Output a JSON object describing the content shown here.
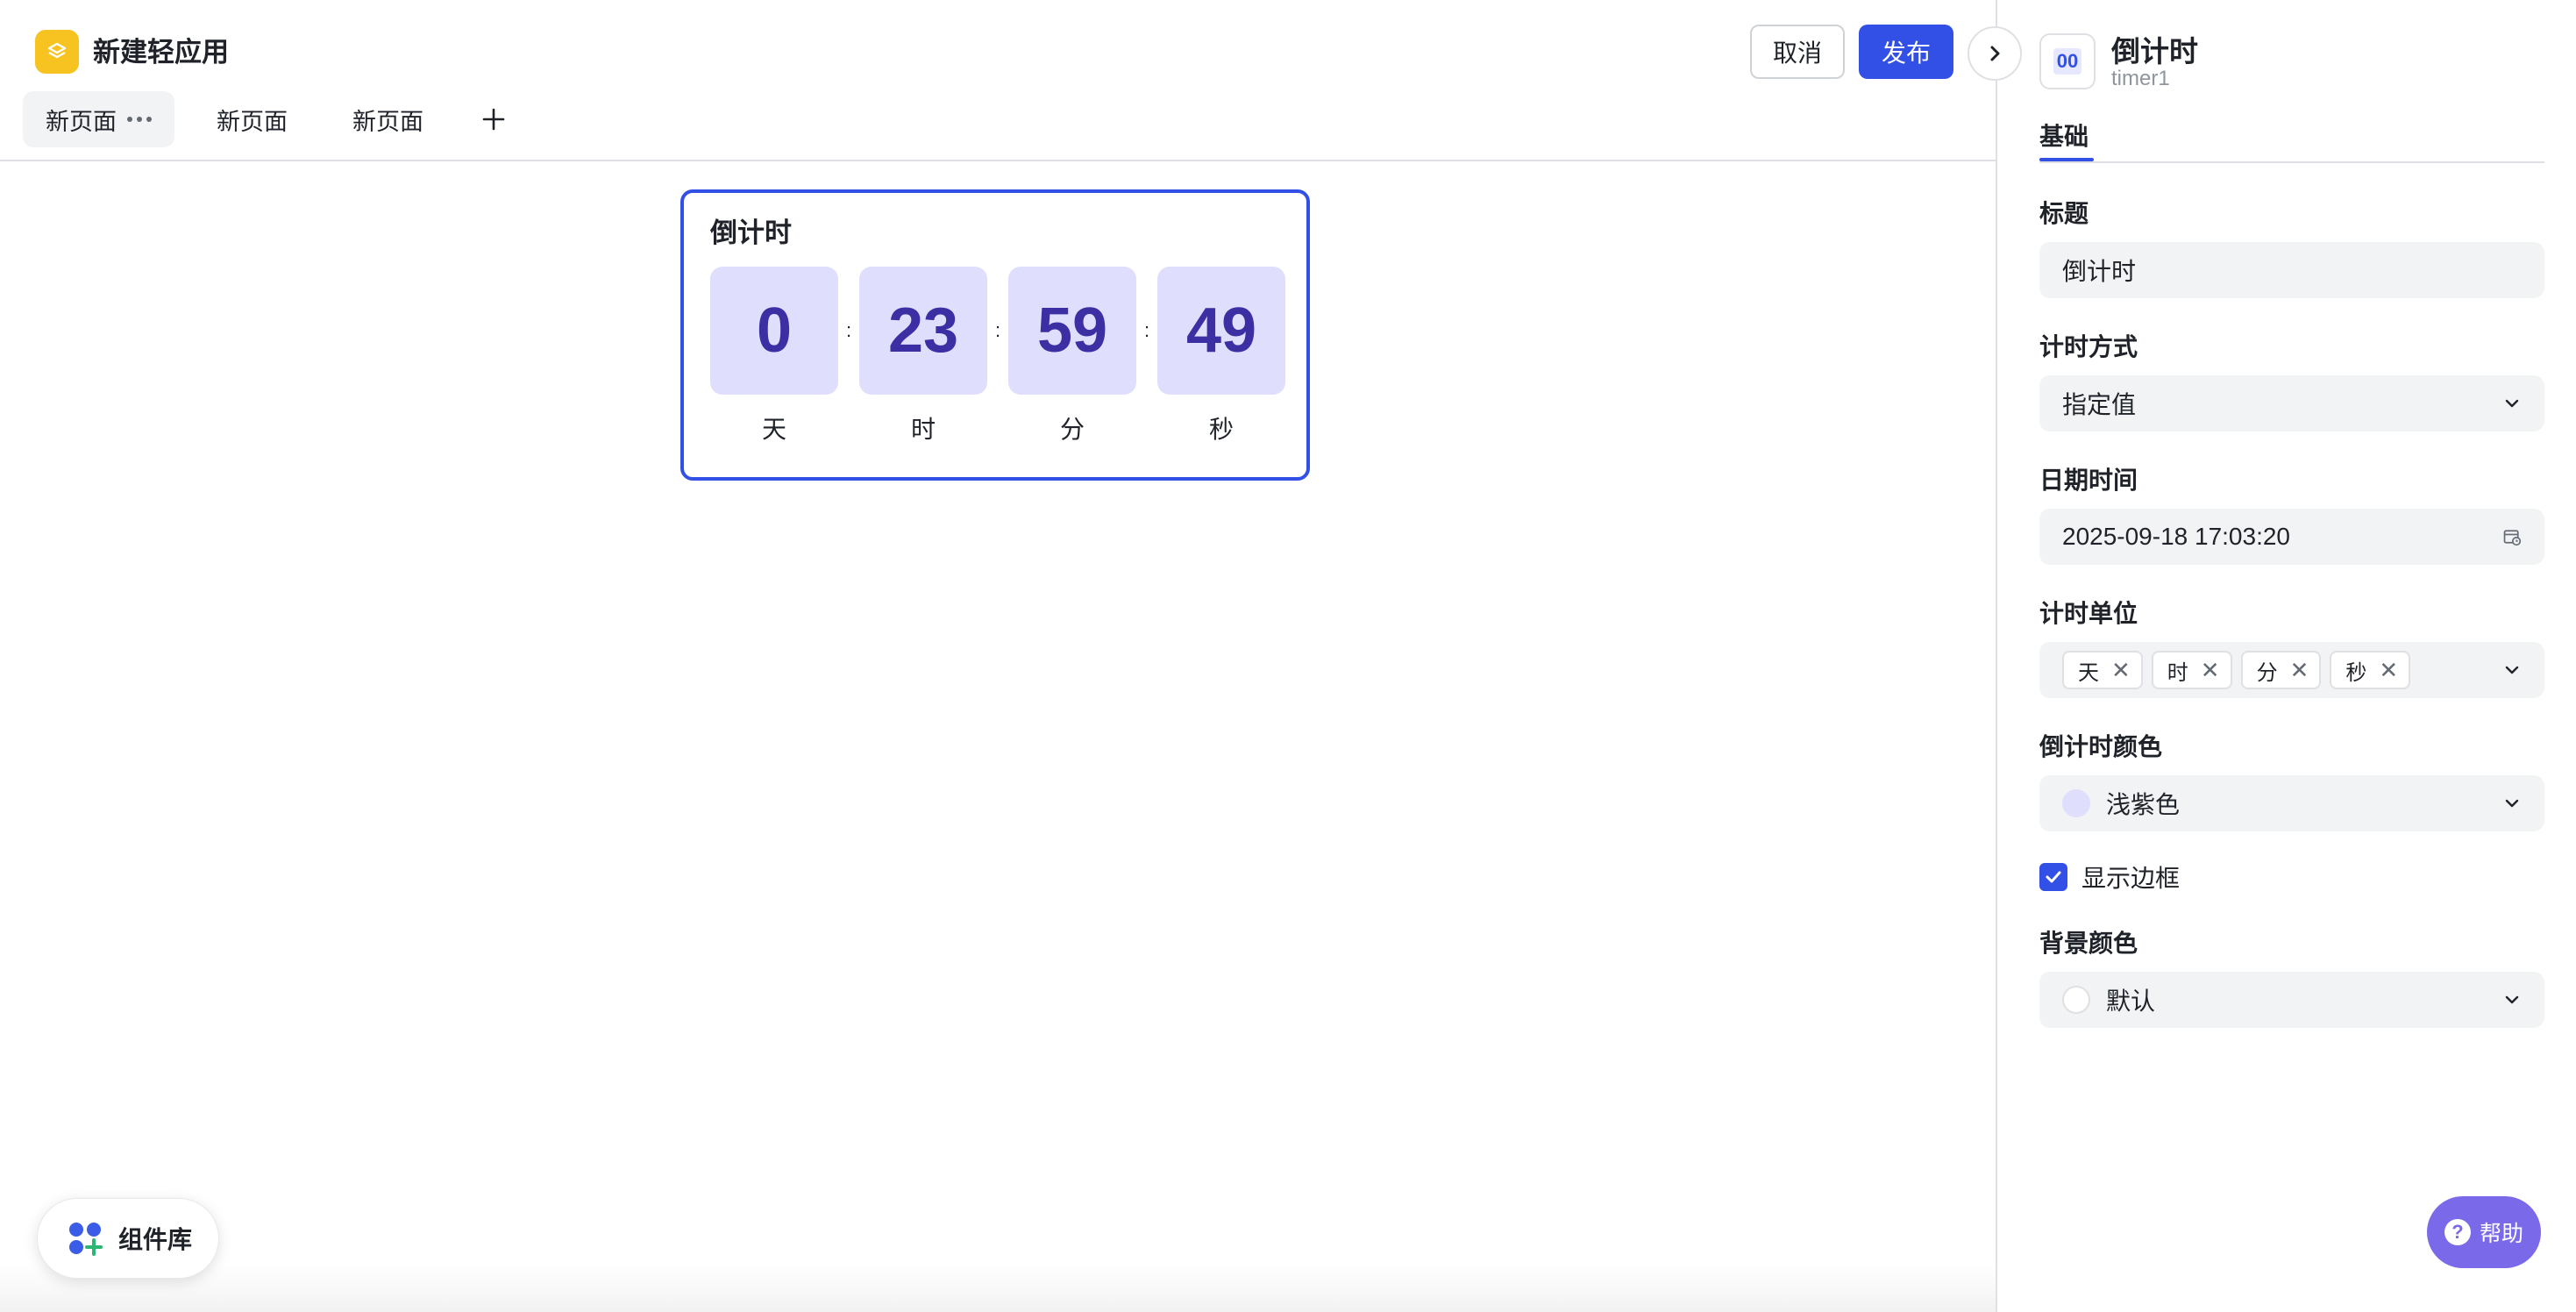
{
  "app": {
    "title": "新建轻应用"
  },
  "tabs": [
    {
      "label": "新页面"
    },
    {
      "label": "新页面"
    },
    {
      "label": "新页面"
    }
  ],
  "toolbar": {
    "cancel_label": "取消",
    "publish_label": "发布"
  },
  "widget": {
    "title": "倒计时",
    "values": {
      "days": "0",
      "hours": "23",
      "minutes": "59",
      "seconds": "49"
    },
    "units": {
      "days": "天",
      "hours": "时",
      "minutes": "分",
      "seconds": "秒"
    },
    "separator": ":"
  },
  "component_library": {
    "label": "组件库"
  },
  "panel": {
    "icon_text": "00",
    "title": "倒计时",
    "id": "timer1",
    "tab": "基础",
    "fields": {
      "title_label": "标题",
      "title_value": "倒计时",
      "mode_label": "计时方式",
      "mode_value": "指定值",
      "datetime_label": "日期时间",
      "datetime_value": "2025-09-18 17:03:20",
      "units_label": "计时单位",
      "units": [
        "天",
        "时",
        "分",
        "秒"
      ],
      "color_label": "倒计时颜色",
      "color_value": "浅紫色",
      "color_hex": "#e0defd",
      "show_border_label": "显示边框",
      "show_border": true,
      "bg_label": "背景颜色",
      "bg_value": "默认"
    }
  },
  "help": {
    "label": "帮助"
  },
  "colors": {
    "accent": "#3350e6",
    "logo": "#f7c320",
    "help": "#7a6ae9"
  }
}
